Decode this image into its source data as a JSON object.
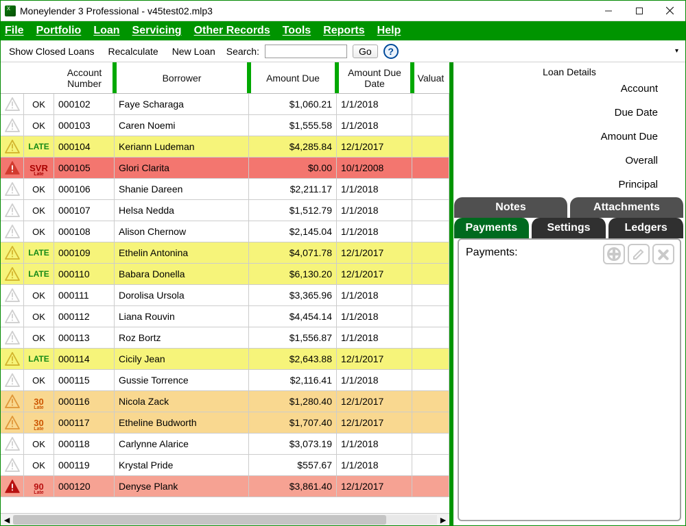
{
  "window": {
    "title": "Moneylender 3 Professional - v45test02.mlp3"
  },
  "menu": {
    "file": "File",
    "portfolio": "Portfolio",
    "loan": "Loan",
    "servicing": "Servicing",
    "other": "Other Records",
    "tools": "Tools",
    "reports": "Reports",
    "help": "Help"
  },
  "toolbar": {
    "show_closed": "Show Closed Loans",
    "recalculate": "Recalculate",
    "new_loan": "New Loan",
    "search_label": "Search:",
    "search_value": "",
    "go": "Go"
  },
  "grid": {
    "headers": {
      "account": "Account Number",
      "borrower": "Borrower",
      "amount_due": "Amount Due",
      "amount_due_date": "Amount Due Date",
      "valuat": "Valuat"
    },
    "rows": [
      {
        "kind": "ok",
        "status": "OK",
        "acct": "000102",
        "borrower": "Faye Scharaga",
        "amount": "$1,060.21",
        "date": "1/1/2018"
      },
      {
        "kind": "ok",
        "status": "OK",
        "acct": "000103",
        "borrower": "Caren Noemi",
        "amount": "$1,555.58",
        "date": "1/1/2018"
      },
      {
        "kind": "late",
        "status": "LATE",
        "acct": "000104",
        "borrower": "Keriann Ludeman",
        "amount": "$4,285.84",
        "date": "12/1/2017"
      },
      {
        "kind": "svr",
        "status": "SVR",
        "sub": "Late",
        "acct": "000105",
        "borrower": "Glori Clarita",
        "amount": "$0.00",
        "date": "10/1/2008"
      },
      {
        "kind": "ok",
        "status": "OK",
        "acct": "000106",
        "borrower": "Shanie Dareen",
        "amount": "$2,211.17",
        "date": "1/1/2018"
      },
      {
        "kind": "ok",
        "status": "OK",
        "acct": "000107",
        "borrower": "Helsa Nedda",
        "amount": "$1,512.79",
        "date": "1/1/2018"
      },
      {
        "kind": "ok",
        "status": "OK",
        "acct": "000108",
        "borrower": "Alison Chernow",
        "amount": "$2,145.04",
        "date": "1/1/2018"
      },
      {
        "kind": "late",
        "status": "LATE",
        "acct": "000109",
        "borrower": "Ethelin Antonina",
        "amount": "$4,071.78",
        "date": "12/1/2017"
      },
      {
        "kind": "late",
        "status": "LATE",
        "acct": "000110",
        "borrower": "Babara Donella",
        "amount": "$6,130.20",
        "date": "12/1/2017"
      },
      {
        "kind": "ok",
        "status": "OK",
        "acct": "000111",
        "borrower": "Dorolisa Ursola",
        "amount": "$3,365.96",
        "date": "1/1/2018"
      },
      {
        "kind": "ok",
        "status": "OK",
        "acct": "000112",
        "borrower": "Liana Rouvin",
        "amount": "$4,454.14",
        "date": "1/1/2018"
      },
      {
        "kind": "ok",
        "status": "OK",
        "acct": "000113",
        "borrower": "Roz Bortz",
        "amount": "$1,556.87",
        "date": "1/1/2018"
      },
      {
        "kind": "late",
        "status": "LATE",
        "acct": "000114",
        "borrower": "Cicily Jean",
        "amount": "$2,643.88",
        "date": "12/1/2017"
      },
      {
        "kind": "ok",
        "status": "OK",
        "acct": "000115",
        "borrower": "Gussie Torrence",
        "amount": "$2,116.41",
        "date": "1/1/2018"
      },
      {
        "kind": "d30",
        "status": "30",
        "sub": "Late",
        "acct": "000116",
        "borrower": "Nicola Zack",
        "amount": "$1,280.40",
        "date": "12/1/2017"
      },
      {
        "kind": "d30",
        "status": "30",
        "sub": "Late",
        "acct": "000117",
        "borrower": "Etheline Budworth",
        "amount": "$1,707.40",
        "date": "12/1/2017"
      },
      {
        "kind": "ok",
        "status": "OK",
        "acct": "000118",
        "borrower": "Carlynne Alarice",
        "amount": "$3,073.19",
        "date": "1/1/2018"
      },
      {
        "kind": "ok",
        "status": "OK",
        "acct": "000119",
        "borrower": "Krystal Pride",
        "amount": "$557.67",
        "date": "1/1/2018"
      },
      {
        "kind": "d90",
        "status": "90",
        "sub": "Late",
        "acct": "000120",
        "borrower": "Denyse Plank",
        "amount": "$3,861.40",
        "date": "12/1/2017"
      }
    ]
  },
  "details": {
    "title": "Loan Details",
    "fields": {
      "account": "Account",
      "due_date": "Due Date",
      "amount_due": "Amount Due",
      "overall": "Overall",
      "principal": "Principal"
    },
    "tabs": {
      "notes": "Notes",
      "attachments": "Attachments",
      "payments": "Payments",
      "settings": "Settings",
      "ledgers": "Ledgers"
    },
    "payments_label": "Payments:"
  },
  "icons": {
    "warn_gray": "#cfcfcf",
    "warn_yellow": "#d2b42e",
    "warn_orange": "#e0973a",
    "warn_red": "#d23a2f",
    "warn_darkred": "#b81010"
  }
}
